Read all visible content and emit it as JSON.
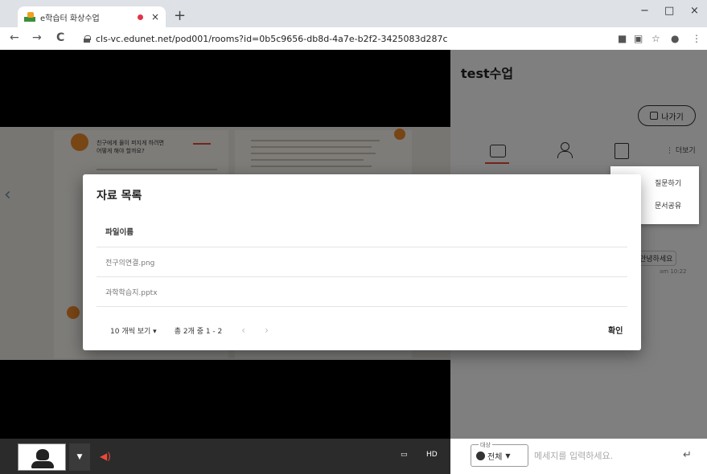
{
  "browser": {
    "tab_title": "e학습터 화상수업",
    "tab_close": "×",
    "new_tab": "+",
    "url": "cls-vc.edunet.net/pod001/rooms?id=0b5c9656-db8d-4a7e-b2f2-3425083d287c",
    "window_controls": [
      "−",
      "□",
      "×"
    ],
    "nav": [
      "←",
      "→",
      "C"
    ]
  },
  "slide": {
    "title_line1": "친구에게 몰이 퍼지게 하려면",
    "title_line2": "어떻게 해야 할까요?"
  },
  "side": {
    "room_title": "test수업",
    "exit_label": "나가기",
    "more_label": "더보기",
    "dropdown": [
      "질문하기",
      "문서공유"
    ],
    "message": "안녕하세요",
    "message_time": "am 10:22"
  },
  "bottom": {
    "target_label": "대상",
    "target_value": "전체",
    "chat_placeholder": "메세지를 입력하세요.",
    "enter": "↵"
  },
  "modal": {
    "title": "자료 목록",
    "column_header": "파일이름",
    "files": [
      "전구의연결.png",
      "과학학습지.pptx"
    ],
    "page_size": "10 개씩 보기 ▾",
    "count": "총 2개 중 1 - 2",
    "confirm": "확인"
  },
  "colors": {
    "accent": "#e84a3a",
    "overlay": "rgba(0,0,0,0.5)"
  }
}
